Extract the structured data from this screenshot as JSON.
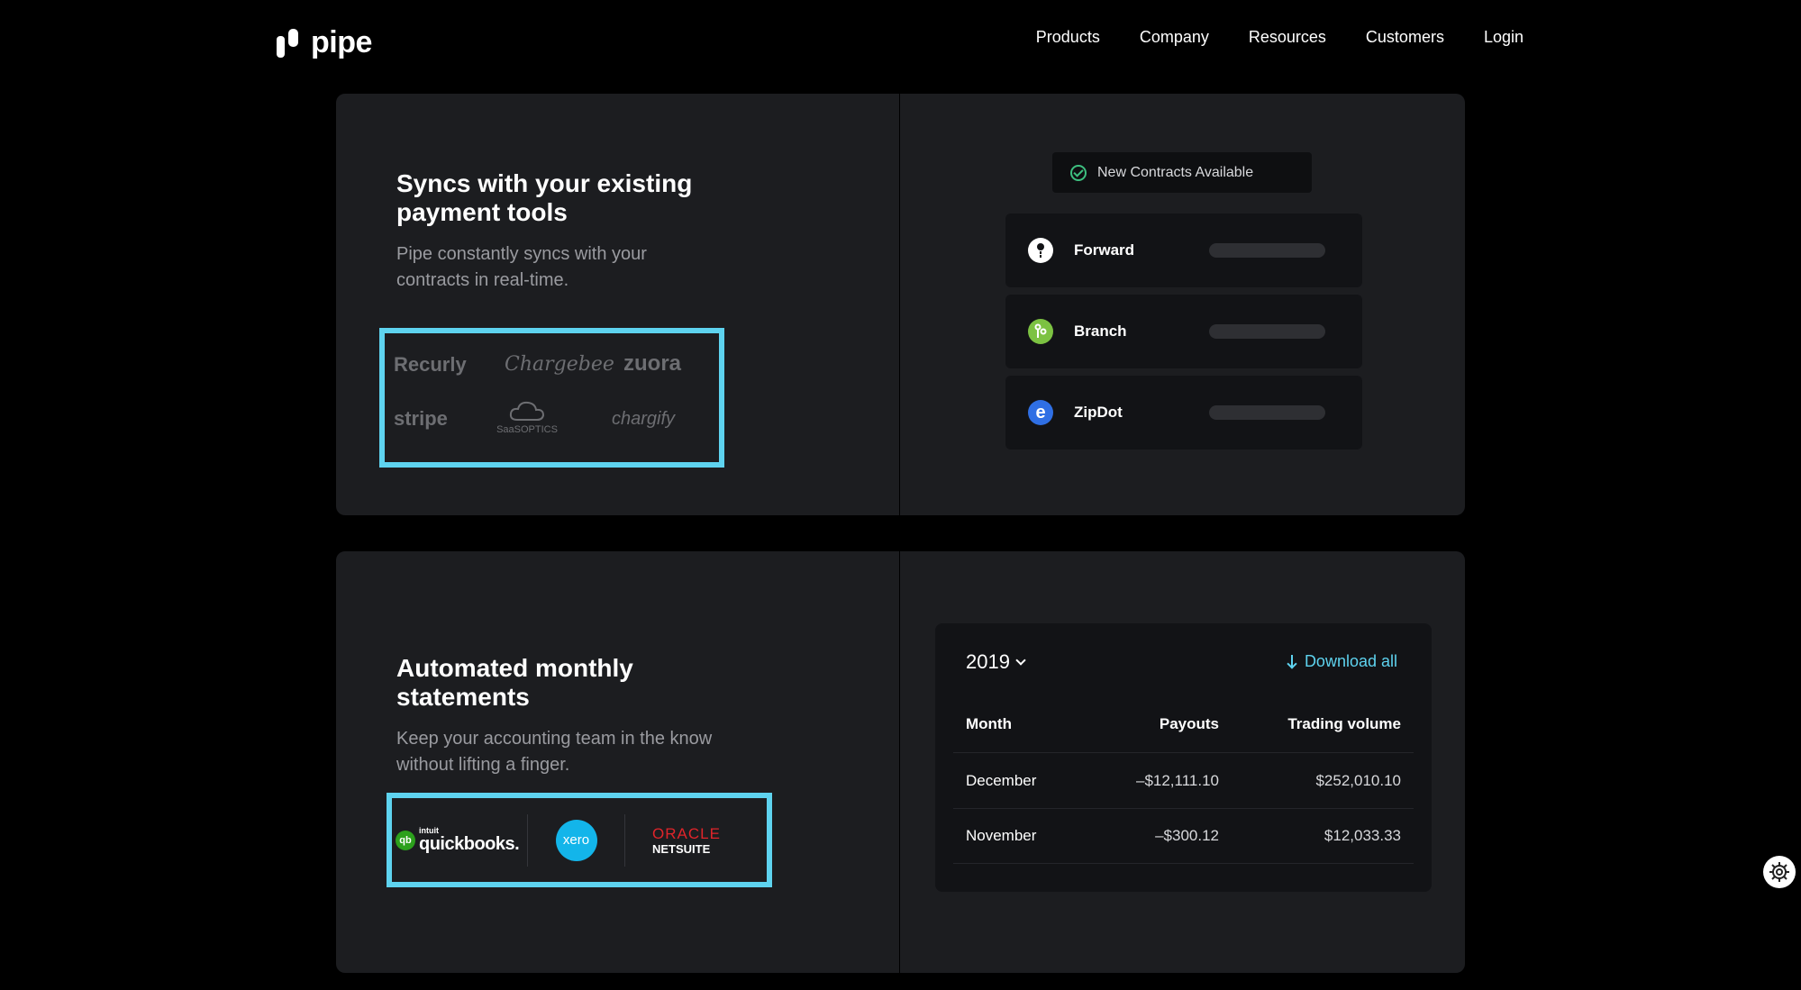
{
  "brand": {
    "name": "pipe"
  },
  "nav": {
    "items": [
      "Products",
      "Company",
      "Resources",
      "Customers",
      "Login"
    ]
  },
  "sync_section": {
    "title": "Syncs with your existing payment tools",
    "description": "Pipe constantly syncs with your contracts in real-time.",
    "payment_logos": [
      "Recurly",
      "Chargebee",
      "zuora",
      "stripe",
      "SaaSOPTICS",
      "chargify"
    ],
    "notice": "New Contracts Available",
    "contracts": [
      {
        "name": "Forward",
        "icon": "forward-logo-icon",
        "color": "#ffffff"
      },
      {
        "name": "Branch",
        "icon": "branch-logo-icon",
        "color": "#7cc242"
      },
      {
        "name": "ZipDot",
        "icon": "zipdot-logo-icon",
        "color": "#2f6fe4"
      }
    ]
  },
  "statements_section": {
    "title": "Automated monthly statements",
    "description": "Keep your accounting team in the know without lifting a finger.",
    "accounting_logos": {
      "quickbooks_small": "intuit",
      "quickbooks": "quickbooks.",
      "qb_badge": "qb",
      "xero": "xero",
      "oracle": "ORACLE",
      "netsuite": "NETSUITE"
    },
    "year": "2019",
    "download_label": "Download all",
    "columns": [
      "Month",
      "Payouts",
      "Trading volume"
    ],
    "rows": [
      {
        "month": "December",
        "payouts": "–$12,111.10",
        "volume": "$252,010.10"
      },
      {
        "month": "November",
        "payouts": "–$300.12",
        "volume": "$12,033.33"
      }
    ]
  },
  "colors": {
    "accent": "#5ed3ef",
    "card": "#1c1d20",
    "highlight": "#5ed3ef",
    "success": "#3dbf7f",
    "oracle_red": "#e0242a"
  }
}
